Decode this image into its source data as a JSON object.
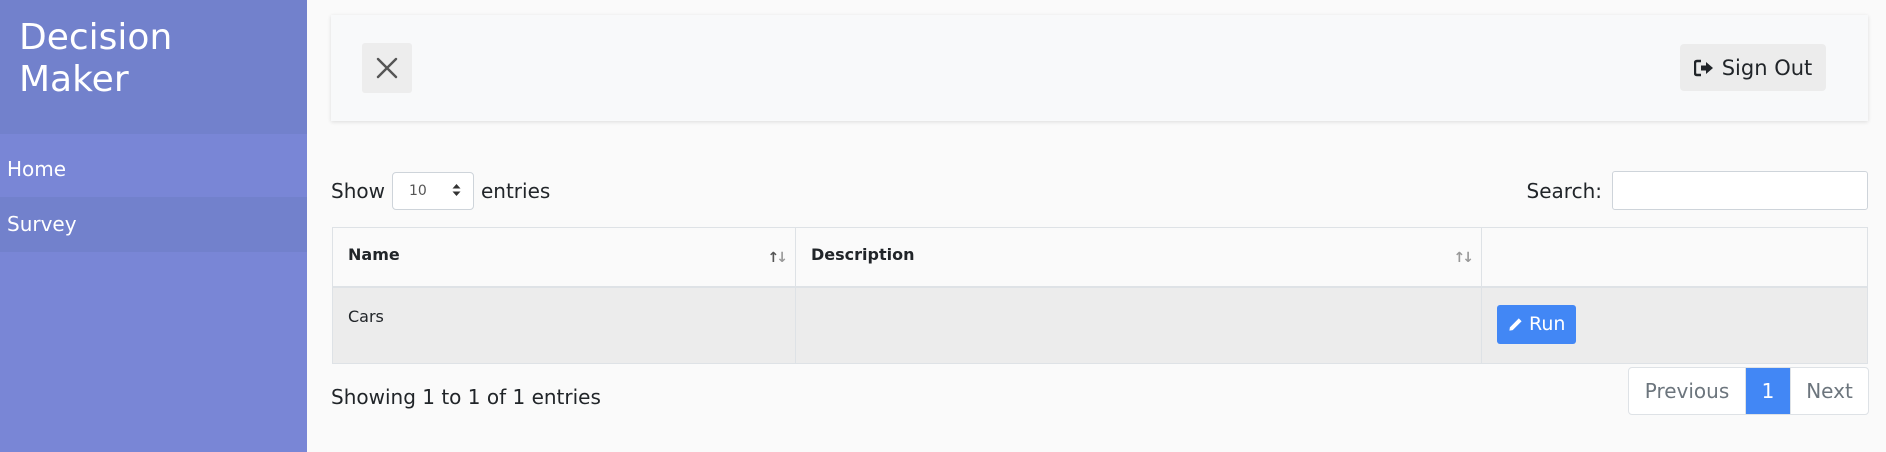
{
  "sidebar": {
    "brand": "Decision Maker",
    "items": [
      {
        "label": "Home"
      },
      {
        "label": "Survey"
      }
    ]
  },
  "topbar": {
    "close_icon": "close-x-icon",
    "signout_label": "Sign Out",
    "signout_icon": "sign-out-icon"
  },
  "table_controls": {
    "show_label": "Show",
    "entries_label": "entries",
    "length_value": "10",
    "search_label": "Search:",
    "search_value": ""
  },
  "table": {
    "columns": [
      "Name",
      "Description",
      ""
    ],
    "rows": [
      {
        "name": "Cars",
        "description": "",
        "action_label": "Run"
      }
    ]
  },
  "footer": {
    "info": "Showing 1 to 1 of 1 entries",
    "previous_label": "Previous",
    "current_page": "1",
    "next_label": "Next"
  },
  "colors": {
    "sidebar": "#7986d6",
    "sidebar_active": "#7281cc",
    "accent": "#4287f5"
  }
}
